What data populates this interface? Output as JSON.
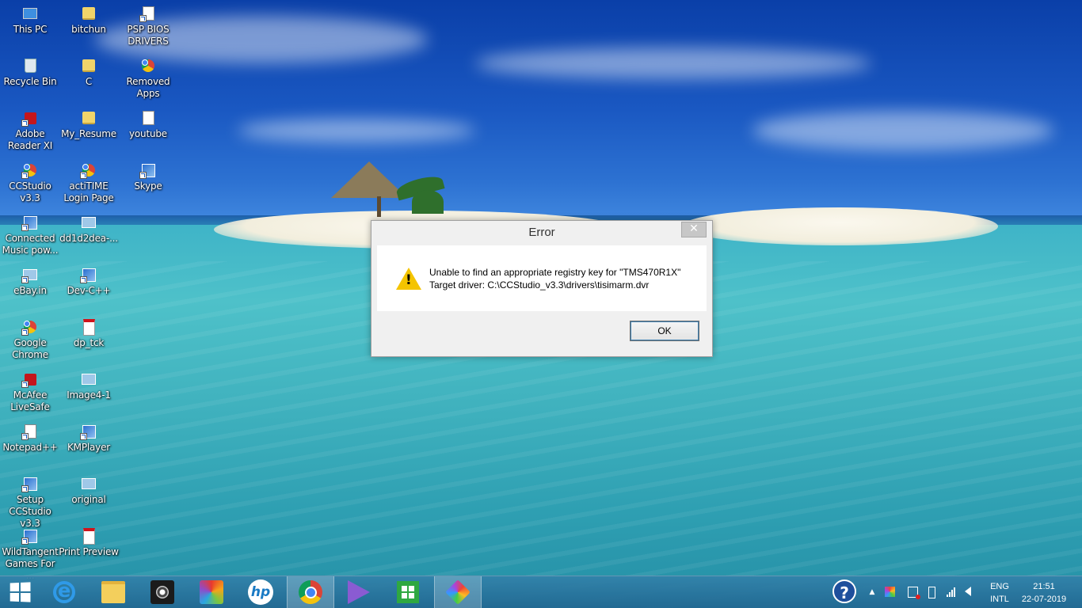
{
  "desktop": {
    "icons": [
      {
        "label": "This PC",
        "icon": "computer-icon"
      },
      {
        "label": "bitchun",
        "icon": "folder-icon"
      },
      {
        "label": "PSP BIOS DRIVERS",
        "icon": "shortcut-icon"
      },
      {
        "label": "Recycle Bin",
        "icon": "recycle-bin-icon"
      },
      {
        "label": "C",
        "icon": "folder-icon"
      },
      {
        "label": "Removed Apps",
        "icon": "chrome-icon"
      },
      {
        "label": "Adobe Reader XI",
        "icon": "adobe-reader-icon"
      },
      {
        "label": "My_Resume",
        "icon": "folder-icon"
      },
      {
        "label": "youtube",
        "icon": "document-icon"
      },
      {
        "label": "CCStudio v3.3",
        "icon": "ccstudio-icon"
      },
      {
        "label": "actiTIME Login Page",
        "icon": "chrome-icon"
      },
      {
        "label": "Skype",
        "icon": "skype-icon"
      },
      {
        "label": "Connected Music pow...",
        "icon": "music-icon"
      },
      {
        "label": "dd1d2dea-...",
        "icon": "image-icon"
      },
      {
        "label": "eBay.in",
        "icon": "shortcut-icon"
      },
      {
        "label": "Dev-C++",
        "icon": "devcpp-icon"
      },
      {
        "label": "Google Chrome",
        "icon": "chrome-icon"
      },
      {
        "label": "dp_tck",
        "icon": "pdf-icon"
      },
      {
        "label": "McAfee LiveSafe",
        "icon": "mcafee-icon"
      },
      {
        "label": "Image4-1",
        "icon": "image-icon"
      },
      {
        "label": "Notepad++",
        "icon": "notepad-icon"
      },
      {
        "label": "KMPlayer",
        "icon": "kmplayer-icon"
      },
      {
        "label": "Setup CCStudio v3.3",
        "icon": "setup-icon"
      },
      {
        "label": "original",
        "icon": "image-icon"
      },
      {
        "label": "WildTangent Games For ...",
        "icon": "wildtangent-icon"
      },
      {
        "label": "Print Preview",
        "icon": "pdf-icon"
      }
    ]
  },
  "dialog": {
    "title": "Error",
    "close_glyph": "✕",
    "icon": "warning-icon",
    "message_line1": "Unable to find an appropriate registry key for \"TMS470R1X\"",
    "message_line2": "Target driver: C:\\CCStudio_v3.3\\drivers\\tisimarm.dvr",
    "ok_label": "OK"
  },
  "taskbar": {
    "pinned": [
      {
        "name": "start-button",
        "icon": "windows-icon"
      },
      {
        "name": "internet-explorer",
        "icon": "internet-explorer-icon"
      },
      {
        "name": "file-explorer",
        "icon": "file-explorer-icon"
      },
      {
        "name": "webcam-app",
        "icon": "webcam-icon"
      },
      {
        "name": "games-app",
        "icon": "puzzle-icon"
      },
      {
        "name": "hp-support",
        "icon": "hp-icon"
      },
      {
        "name": "google-chrome",
        "icon": "chrome-icon",
        "active": true
      },
      {
        "name": "visual-studio",
        "icon": "visual-studio-icon"
      },
      {
        "name": "windows-store",
        "icon": "store-icon"
      },
      {
        "name": "ccstudio",
        "icon": "cube-icon",
        "active": true
      }
    ],
    "tray": {
      "help_glyph": "?",
      "expand_glyph": "▲",
      "language_primary": "ENG",
      "language_secondary": "INTL",
      "time": "21:51",
      "date": "22-07-2019"
    }
  },
  "colors": {
    "accent_taskbar": "#2a77a0",
    "warning_yellow": "#f4c400",
    "dialog_bg": "#f0f0f0"
  }
}
